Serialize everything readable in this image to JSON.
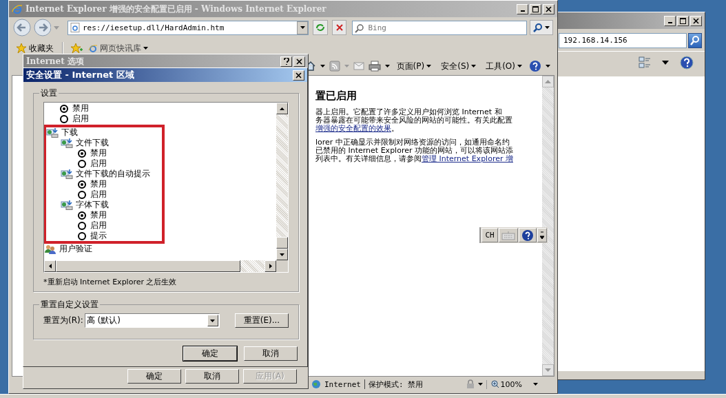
{
  "back_window": {
    "address": "192.168.14.156"
  },
  "ie_window": {
    "title": "Internet Explorer 增强的安全配置已启用 - Windows Internet Explorer",
    "address": "res://iesetup.dll/HardAdmin.htm",
    "search": {
      "placeholder": "Bing"
    },
    "favorites": "收藏夹",
    "favorites_items": [
      "网页快讯库"
    ],
    "commands": [
      "页面(P)",
      "安全(S)",
      "工具(O)"
    ],
    "page": {
      "heading": "置已启用",
      "paragraphs": [
        [
          [
            {
              "text": "器上启用。它配置了许多定义用户如何浏览 Internet 和",
              "link": false
            }
          ],
          [
            {
              "text": "务器暴露在可能带来安全风险的网站的可能性。有关此配置",
              "link": false
            }
          ],
          [
            {
              "text": "增强的安全配置的效果",
              "link": true
            },
            {
              "text": "。",
              "link": false
            }
          ]
        ],
        [
          [
            {
              "text": "lorer 中正确显示并限制对网络资源的访问，如通用命名约",
              "link": false
            }
          ],
          [
            {
              "text": "已禁用的 Internet Explorer 功能的网站，可以将该网站添",
              "link": false
            }
          ],
          [
            {
              "text": "列表中。有关详细信息，请参阅",
              "link": false
            },
            {
              "text": "管理 Internet Explorer 增",
              "link": true
            }
          ]
        ]
      ]
    },
    "status_bar": {
      "zone": "Internet",
      "protected_mode": "保护模式: 禁用",
      "zoom": "100%"
    }
  },
  "language_bar": {
    "language": "CH"
  },
  "internet_options": {
    "title": "Internet 选项",
    "buttons": [
      {
        "label": "确定",
        "disabled": false
      },
      {
        "label": "取消",
        "disabled": false
      },
      {
        "label": "应用(A)",
        "disabled": true
      }
    ]
  },
  "security_dialog": {
    "title": "安全设置 - Internet 区域",
    "settings_group": "设置",
    "tree": [
      {
        "kind": "option",
        "label": "禁用",
        "selected": true
      },
      {
        "kind": "option",
        "label": "启用",
        "selected": false
      },
      {
        "kind": "setting",
        "label": "下载",
        "highlighted": true,
        "children": [
          {
            "kind": "setting",
            "label": "文件下载",
            "children": [
              {
                "kind": "option",
                "label": "禁用",
                "selected": true
              },
              {
                "kind": "option",
                "label": "启用",
                "selected": false
              }
            ]
          },
          {
            "kind": "setting",
            "label": "文件下载的自动提示",
            "children": [
              {
                "kind": "option",
                "label": "禁用",
                "selected": true
              },
              {
                "kind": "option",
                "label": "启用",
                "selected": false
              }
            ]
          },
          {
            "kind": "setting",
            "label": "字体下载",
            "children": [
              {
                "kind": "option",
                "label": "禁用",
                "selected": true
              },
              {
                "kind": "option",
                "label": "启用",
                "selected": false
              },
              {
                "kind": "option",
                "label": "提示",
                "selected": false
              }
            ]
          }
        ]
      },
      {
        "kind": "account",
        "label": "用户验证"
      }
    ],
    "note": "*重新启动 Internet Explorer 之后生效",
    "reset_group": "重置自定义设置",
    "reset_label": "重置为(R):",
    "reset_value": "高 (默认)",
    "reset_button": "重置(E)...",
    "buttons": [
      {
        "label": "确定",
        "default": true
      },
      {
        "label": "取消",
        "default": false
      }
    ]
  }
}
